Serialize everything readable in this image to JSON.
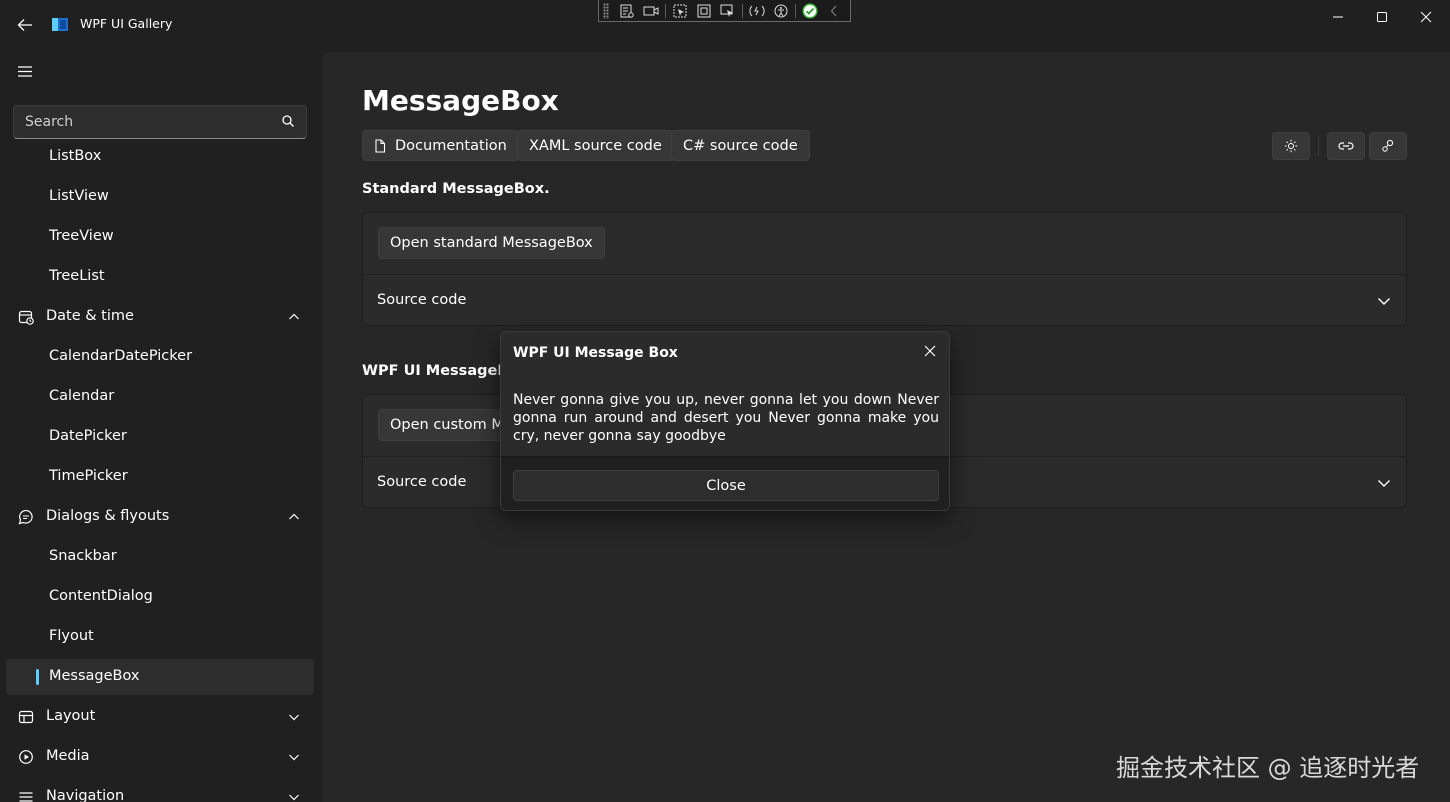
{
  "app": {
    "title": "WPF UI Gallery"
  },
  "search": {
    "placeholder": "Search"
  },
  "sidebar": {
    "items": [
      {
        "label": "ListBox",
        "kind": "child"
      },
      {
        "label": "ListView",
        "kind": "child"
      },
      {
        "label": "TreeView",
        "kind": "child"
      },
      {
        "label": "TreeList",
        "kind": "child"
      },
      {
        "label": "Date & time",
        "kind": "parent",
        "icon": "calendar-clock-icon",
        "expanded": true
      },
      {
        "label": "CalendarDatePicker",
        "kind": "child"
      },
      {
        "label": "Calendar",
        "kind": "child"
      },
      {
        "label": "DatePicker",
        "kind": "child"
      },
      {
        "label": "TimePicker",
        "kind": "child"
      },
      {
        "label": "Dialogs & flyouts",
        "kind": "parent",
        "icon": "chat-bubble-icon",
        "expanded": true
      },
      {
        "label": "Snackbar",
        "kind": "child"
      },
      {
        "label": "ContentDialog",
        "kind": "child"
      },
      {
        "label": "Flyout",
        "kind": "child"
      },
      {
        "label": "MessageBox",
        "kind": "child",
        "selected": true
      },
      {
        "label": "Layout",
        "kind": "parent",
        "icon": "layout-icon",
        "expanded": false
      },
      {
        "label": "Media",
        "kind": "parent",
        "icon": "media-play-icon",
        "expanded": false
      },
      {
        "label": "Navigation",
        "kind": "parent",
        "icon": "navigation-icon",
        "expanded": false
      }
    ]
  },
  "page": {
    "title": "MessageBox",
    "links": {
      "documentation": "Documentation",
      "xaml": "XAML source code",
      "csharp": "C# source code"
    },
    "toolbar_icons": [
      "theme-sun-icon",
      "link-icon",
      "github-icon"
    ],
    "sections": [
      {
        "title": "Standard MessageBox.",
        "button": "Open standard MessageBox",
        "source_label": "Source code"
      },
      {
        "title": "WPF UI MessageBox.",
        "button": "Open custom MessageBox",
        "source_label": "Source code"
      }
    ]
  },
  "messagebox": {
    "title": "WPF UI Message Box",
    "text": "Never gonna give you up, never gonna let you down Never gonna run around and desert you Never gonna make you cry, never gonna say goodbye",
    "close_label": "Close"
  },
  "watermark": "掘金技术社区 @ 追逐时光者",
  "colors": {
    "accent": "#60cdff",
    "background": "#202020",
    "content": "#272727",
    "card": "#2b2b2b"
  }
}
